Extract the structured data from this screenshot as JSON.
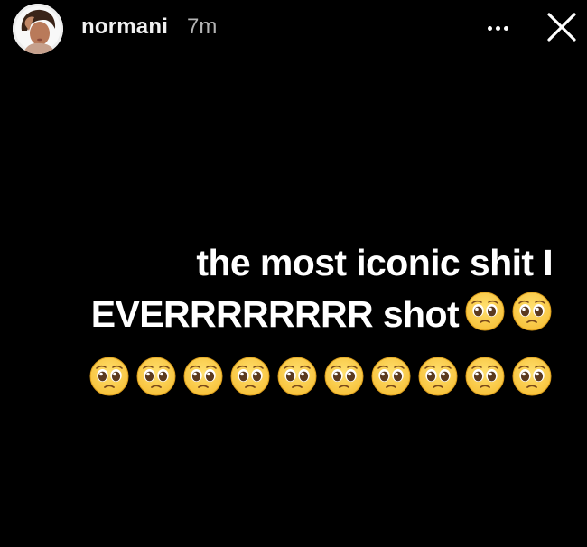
{
  "story": {
    "username": "normani",
    "time_ago": "7m",
    "avatar_icon": "profile-photo",
    "more_icon": "more-horizontal-icon",
    "close_icon": "close-icon"
  },
  "caption": {
    "line1": "the most iconic shit I",
    "line2": "EVERRRRRRRR shot",
    "emoji": "🥺",
    "emoji_line2_count": 2,
    "emoji_line3_count": 10
  },
  "colors": {
    "background": "#000000",
    "text": "#ffffff",
    "time_text": "#b4b4b4",
    "emoji_face": "#f7c23b"
  }
}
